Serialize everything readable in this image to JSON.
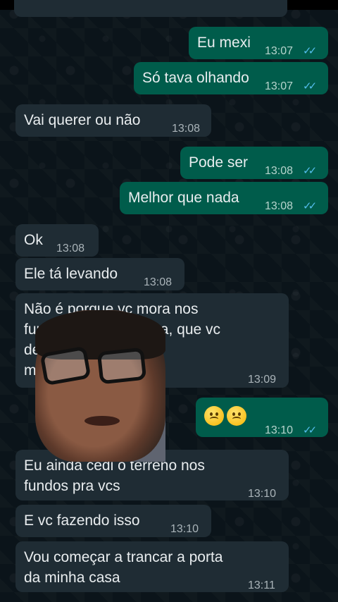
{
  "messages": [
    {
      "text": "Eu mexi",
      "time": "13:07",
      "dir": "out"
    },
    {
      "text": "Só tava olhando",
      "time": "13:07",
      "dir": "out"
    },
    {
      "text": "Vai querer ou não",
      "time": "13:08",
      "dir": "in"
    },
    {
      "text": "Pode ser",
      "time": "13:08",
      "dir": "out"
    },
    {
      "text": "Melhor que nada",
      "time": "13:08",
      "dir": "out"
    },
    {
      "text": "Ok",
      "time": "13:08",
      "dir": "in"
    },
    {
      "text": "Ele tá levando",
      "time": "13:08",
      "dir": "in"
    },
    {
      "text": "Não é porque vc mora nos\nfundos da minha casa, que vc\nde... minha casa e\nm... a geladeira",
      "time": "13:09",
      "dir": "in"
    },
    {
      "emojis": [
        "confused-face",
        "confused-face"
      ],
      "time": "13:10",
      "dir": "out"
    },
    {
      "text": "Eu ainda cedi o terreno nos\nfundos pra vcs",
      "time": "13:10",
      "dir": "in"
    },
    {
      "text": "E vc fazendo isso",
      "time": "13:10",
      "dir": "in"
    },
    {
      "text": "Vou começar a trancar a porta\nda minha casa",
      "time": "13:11",
      "dir": "in"
    }
  ],
  "read_ticks": "✓✓",
  "colors": {
    "incoming": "#1f2c34",
    "outgoing": "#005c4b",
    "tick_blue": "#53bdeb",
    "background": "#0b141a"
  }
}
